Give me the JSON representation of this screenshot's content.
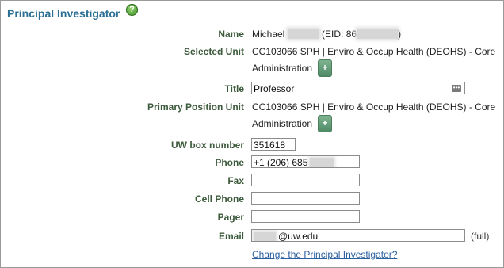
{
  "section": {
    "title": "Principal Investigator",
    "help_icon": "question-icon",
    "help_glyph": "?"
  },
  "labels": {
    "name": "Name",
    "selected_unit": "Selected Unit",
    "title": "Title",
    "primary_position_unit": "Primary Position Unit",
    "uw_box": "UW box number",
    "phone": "Phone",
    "fax": "Fax",
    "cell_phone": "Cell Phone",
    "pager": "Pager",
    "email": "Email"
  },
  "values": {
    "name_first": "Michael",
    "name_eid_prefix": "(EID: 86",
    "name_close": ")",
    "selected_unit_line1": "CC103066 SPH | Enviro & Occup Health (DEOHS) - Core",
    "selected_unit_line2": "Administration",
    "primary_unit_line1": "CC103066 SPH | Enviro & Occup Health (DEOHS) - Core",
    "primary_unit_line2": "Administration",
    "plus_glyph": "+"
  },
  "inputs": {
    "title": "Professor",
    "uw_box": "351618",
    "phone": "+1 (206) 685",
    "fax": "",
    "cell_phone": "",
    "pager": "",
    "email_suffix": "@uw.edu"
  },
  "email_note": "(full)",
  "change_link": "Change the Principal Investigator?",
  "colors": {
    "title": "#2b6f95",
    "label": "#3c5a3c",
    "link": "#2b5fa0",
    "plus_button": "#5e9a72"
  }
}
